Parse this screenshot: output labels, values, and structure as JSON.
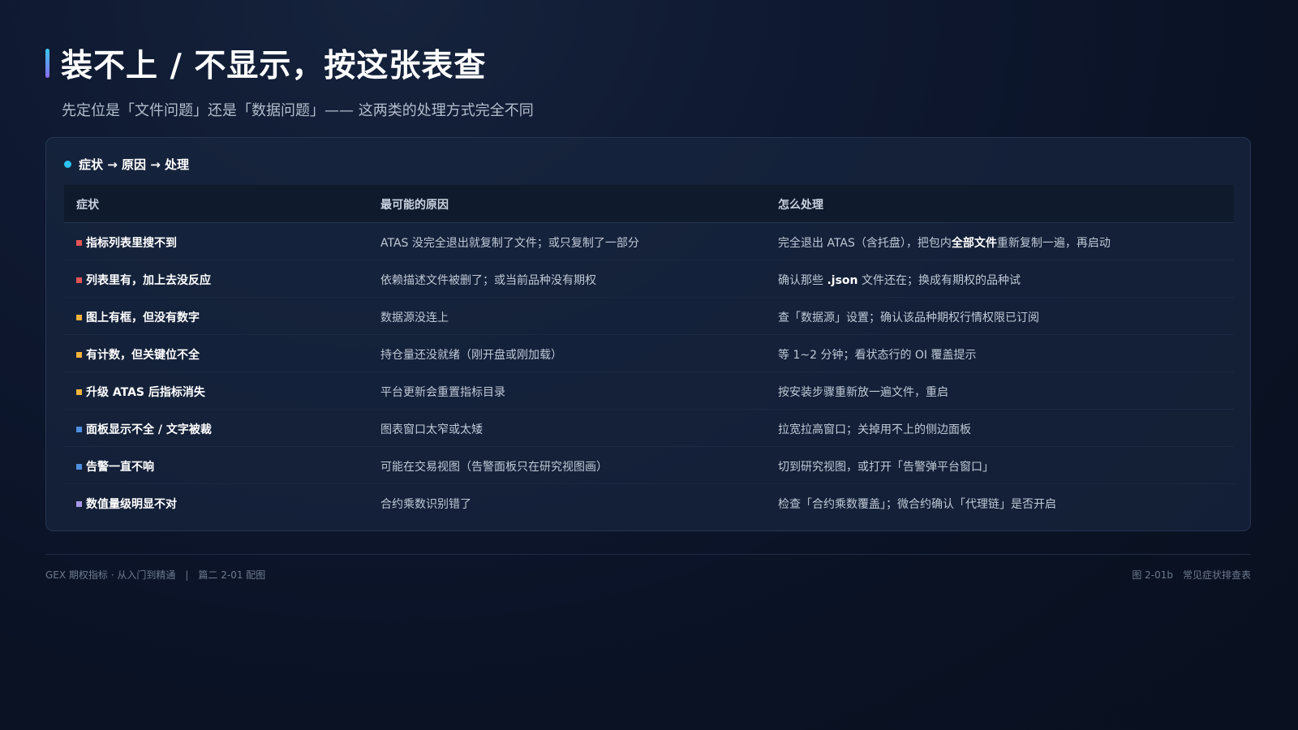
{
  "header": {
    "title": "装不上 / 不显示，按这张表查",
    "subtitle": "先定位是「文件问题」还是「数据问题」—— 这两类的处理方式完全不同"
  },
  "card": {
    "heading": "症状 → 原因 → 处理",
    "columns": [
      "症状",
      "最可能的原因",
      "怎么处理"
    ],
    "rows": [
      {
        "symptom": "指标列表里搜不到",
        "marker_color": "#e25555",
        "cause": "ATAS 没完全退出就复制了文件；或只复制了一部分",
        "fix_before": "完全退出 ATAS（含托盘），把包内",
        "fix_bold": "全部文件",
        "fix_after": "重新复制一遍，再启动"
      },
      {
        "symptom": "列表里有，加上去没反应",
        "marker_color": "#e25555",
        "cause": "依赖描述文件被删了；或当前品种没有期权",
        "fix_before": "确认那些 ",
        "fix_bold": ".json",
        "fix_after": " 文件还在；换成有期权的品种试"
      },
      {
        "symptom": "图上有框，但没有数字",
        "marker_color": "#f2b33d",
        "cause": "数据源没连上",
        "fix_before": "查「数据源」设置；确认该品种期权行情权限已订阅",
        "fix_bold": "",
        "fix_after": ""
      },
      {
        "symptom": "有计数，但关键位不全",
        "marker_color": "#f2b33d",
        "cause": "持仓量还没就绪（刚开盘或刚加载）",
        "fix_before": "等 1~2 分钟；看状态行的 OI 覆盖提示",
        "fix_bold": "",
        "fix_after": ""
      },
      {
        "symptom": "升级 ATAS 后指标消失",
        "marker_color": "#f2b33d",
        "cause": "平台更新会重置指标目录",
        "fix_before": "按安装步骤重新放一遍文件，重启",
        "fix_bold": "",
        "fix_after": ""
      },
      {
        "symptom": "面板显示不全 / 文字被裁",
        "marker_color": "#4f8fe0",
        "cause": "图表窗口太窄或太矮",
        "fix_before": "拉宽拉高窗口；关掉用不上的侧边面板",
        "fix_bold": "",
        "fix_after": ""
      },
      {
        "symptom": "告警一直不响",
        "marker_color": "#4f8fe0",
        "cause": "可能在交易视图（告警面板只在研究视图画）",
        "fix_before": "切到研究视图，或打开「告警弹平台窗口」",
        "fix_bold": "",
        "fix_after": ""
      },
      {
        "symptom": "数值量级明显不对",
        "marker_color": "#a898e8",
        "cause": "合约乘数识别错了",
        "fix_before": "检查「合约乘数覆盖」；微合约确认「代理链」是否开启",
        "fix_bold": "",
        "fix_after": ""
      }
    ]
  },
  "footer": {
    "left_series": "GEX 期权指标 · 从入门到精通",
    "separator": "|",
    "left_chapter": "篇二 2-01 配图",
    "right_figure": "图 2-01b",
    "right_caption": "常见症状排查表"
  },
  "colors": {
    "accent_cyan": "#2cc3f2",
    "accent_purple": "#8a6cf0",
    "background": "#0a1224"
  }
}
